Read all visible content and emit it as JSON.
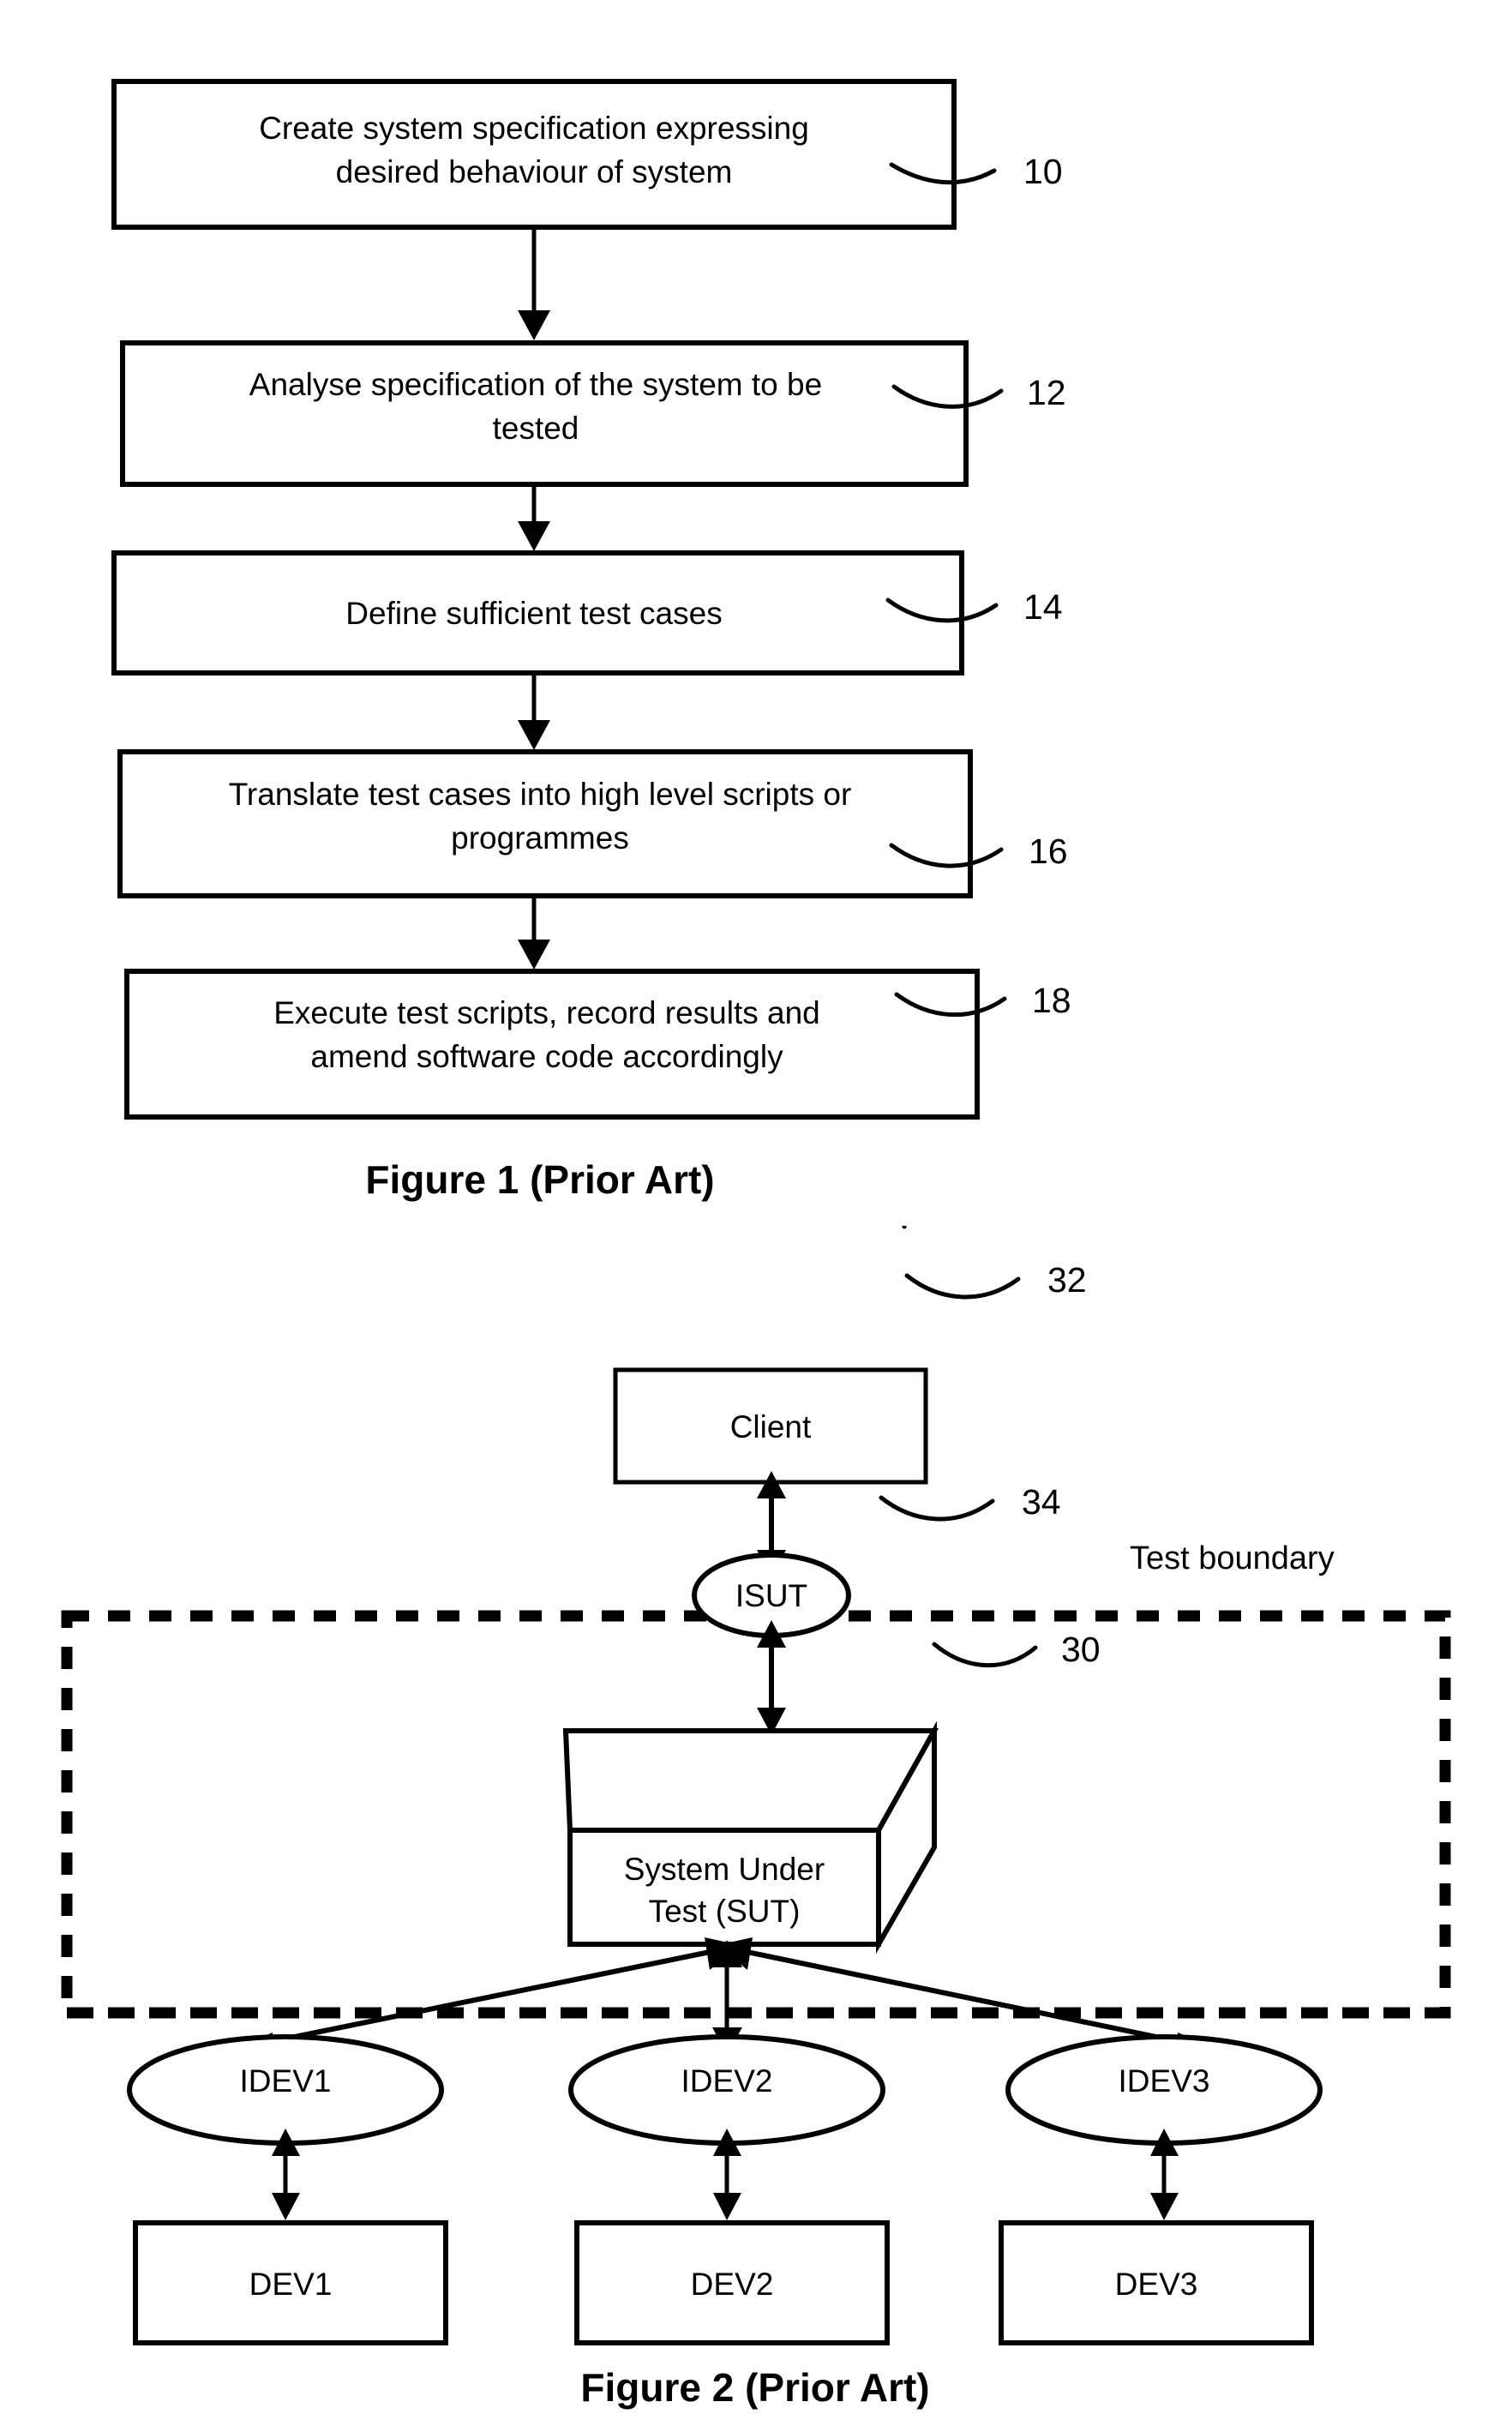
{
  "document": {
    "type": "patent-figure-sheet",
    "figures": [
      {
        "id": "figure-1",
        "caption": "Figure 1  (Prior Art)",
        "kind": "flowchart",
        "steps": [
          {
            "ref": "10",
            "lines": [
              "Create system specification expressing",
              "desired behaviour of system"
            ]
          },
          {
            "ref": "12",
            "lines": [
              "Analyse specification of the system to be",
              "tested"
            ]
          },
          {
            "ref": "14",
            "lines": [
              "Define sufficient test cases"
            ]
          },
          {
            "ref": "16",
            "lines": [
              "Translate test cases into high level scripts or",
              "programmes"
            ]
          },
          {
            "ref": "18",
            "lines": [
              "Execute test scripts, record results and",
              "amend software code accordingly"
            ]
          }
        ]
      },
      {
        "id": "figure-2",
        "caption": "Figure 2  (Prior Art)",
        "kind": "block-diagram",
        "boundary_label": "Test boundary",
        "nodes": {
          "client": {
            "label": "Client",
            "ref": "32"
          },
          "isut": {
            "label": "ISUT",
            "ref": "34"
          },
          "sut": {
            "lines": [
              "System Under",
              "Test (SUT)"
            ],
            "ref": "30"
          },
          "interfaces": [
            {
              "label": "IDEV1"
            },
            {
              "label": "IDEV2"
            },
            {
              "label": "IDEV3"
            }
          ],
          "devices": [
            {
              "label": "DEV1"
            },
            {
              "label": "DEV2"
            },
            {
              "label": "DEV3"
            }
          ]
        }
      }
    ]
  },
  "colors": {
    "ink": "#000000",
    "paper": "#ffffff"
  }
}
